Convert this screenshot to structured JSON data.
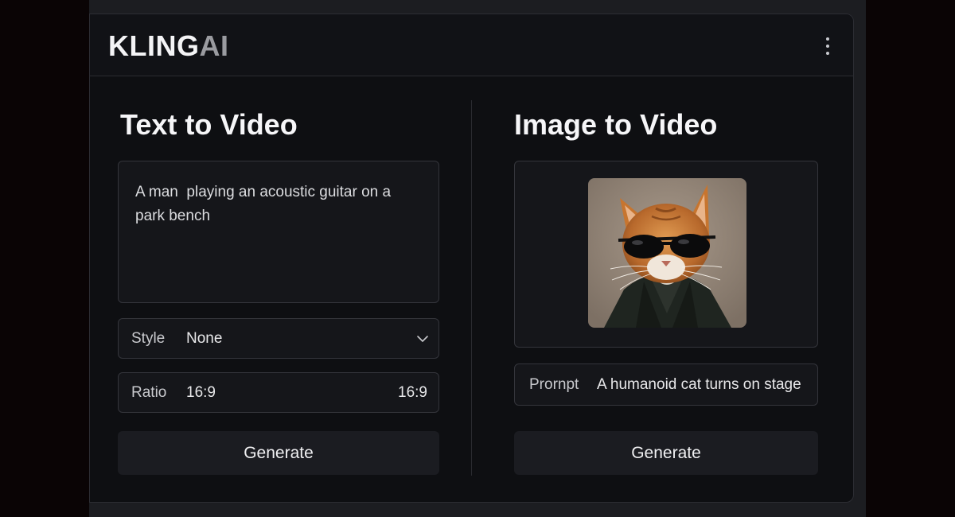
{
  "app": {
    "logo_main": "KLING",
    "logo_accent": "AI"
  },
  "text_to_video": {
    "title": "Text to Video",
    "prompt_value": "A man  playing an acoustic guitar on a park bench",
    "style_label": "Style",
    "style_value": "None",
    "ratio_label": "Ratio",
    "ratio_value": "16:9",
    "ratio_right": "16:9",
    "generate_label": "Generate"
  },
  "image_to_video": {
    "title": "Image to Video",
    "prompt_label": "Prornpt",
    "prompt_value": "A humanoid cat turns on stage",
    "generate_label": "Generate"
  },
  "icons": {
    "menu": "vertical-ellipsis-icon",
    "style_dropdown": "chevron-down-icon"
  },
  "colors": {
    "background": "#0e0f12",
    "panel": "#15161a",
    "button": "#1b1c21",
    "logo_accent": "#9a9ba0"
  }
}
